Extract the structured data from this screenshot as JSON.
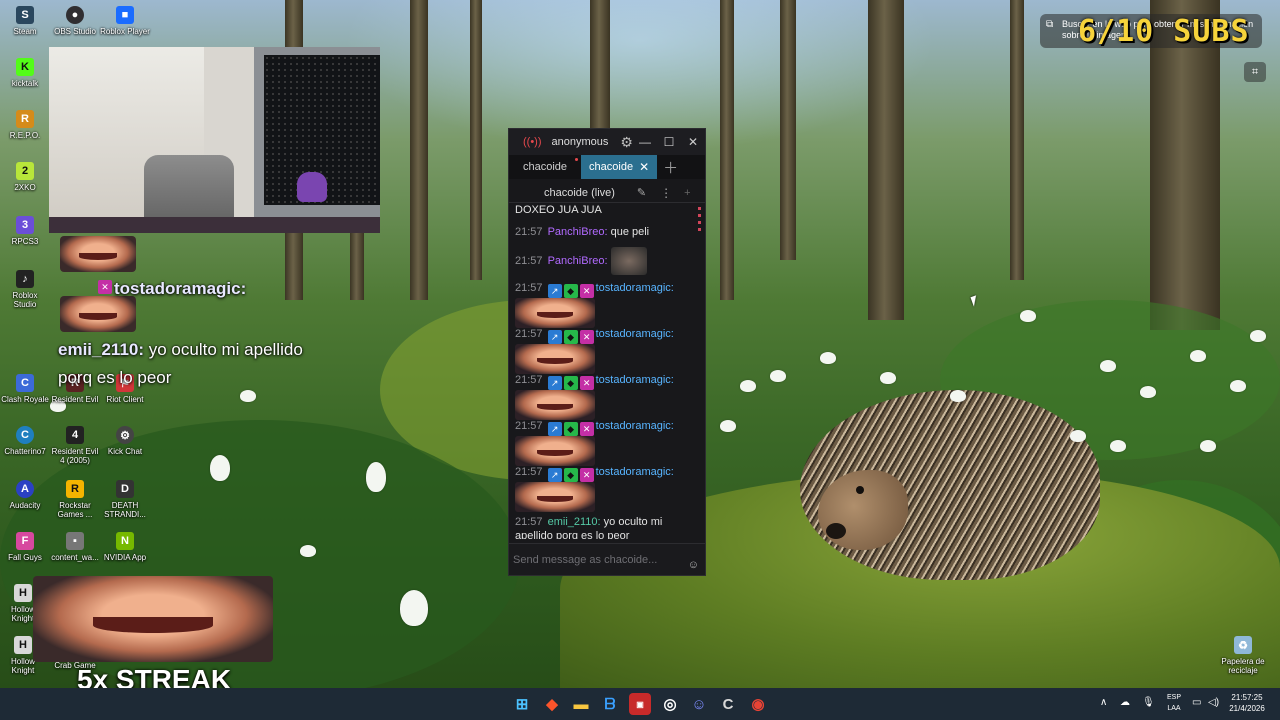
{
  "desktop_icons": [
    {
      "label": "Steam",
      "icon": "steam-icon",
      "color": "#2a475e"
    },
    {
      "label": "OBS Studio",
      "icon": "obs-icon",
      "color": "#302e31"
    },
    {
      "label": "Roblox Player",
      "icon": "roblox-icon",
      "color": "#1b6cff"
    },
    {
      "label": "kicktalk",
      "icon": "kicktalk-icon",
      "color": "#53fc18"
    },
    {
      "label": "R.E.P.O.",
      "icon": "repo-icon",
      "color": "#d58b1a"
    },
    {
      "label": "2XKO",
      "icon": "2xko-icon",
      "color": "#b8e63a"
    },
    {
      "label": "RPCS3",
      "icon": "rpcs3-icon",
      "color": "#6b4fd8"
    },
    {
      "label": "Roblox Studio",
      "icon": "roblox-studio-icon",
      "color": "#222"
    },
    {
      "label": "Clash Royale",
      "icon": "clash-royale-icon",
      "color": "#3c6ad8"
    },
    {
      "label": "Resident Evil",
      "icon": "resident-evil-icon",
      "color": "#5a2222"
    },
    {
      "label": "Riot Client",
      "icon": "riot-client-icon",
      "color": "#d13639"
    },
    {
      "label": "Chatterino7",
      "icon": "chatterino-icon",
      "color": "#1f7fbf"
    },
    {
      "label": "Resident Evil 4 (2005)",
      "icon": "resident-evil-4-icon",
      "color": "#222"
    },
    {
      "label": "Kick Chat",
      "icon": "kick-chat-icon",
      "color": "#444"
    },
    {
      "label": "Audacity",
      "icon": "audacity-icon",
      "color": "#2b41c4"
    },
    {
      "label": "Rockstar Games ...",
      "icon": "rockstar-icon",
      "color": "#f4b400"
    },
    {
      "label": "DEATH STRANDI...",
      "icon": "death-stranding-icon",
      "color": "#333"
    },
    {
      "label": "Fall Guys",
      "icon": "fall-guys-icon",
      "color": "#d7489f"
    },
    {
      "label": "content_wa...",
      "icon": "content-icon",
      "color": "#777"
    },
    {
      "label": "NVIDIA App",
      "icon": "nvidia-icon",
      "color": "#76b900"
    },
    {
      "label": "Hollow Knight",
      "icon": "hollow-knight-icon",
      "color": "#d8d8d8"
    },
    {
      "label": "Crab Game",
      "icon": "crab-game-icon",
      "color": "#c33"
    },
    {
      "label": "Hollow Knight",
      "icon": "hollow-knight-icon",
      "color": "#d8d8d8"
    },
    {
      "label": "Papelera de reciclaje",
      "icon": "recycle-bin-icon",
      "color": "#8fb8d8"
    }
  ],
  "overlay": {
    "alert_user": "tostadoramagic:",
    "alert_chat_user": "emii_2110:",
    "alert_chat_text_line1": " yo oculto mi apellido",
    "alert_chat_text_line2": "porq es lo peor",
    "subs": "6/10 SUBS",
    "streak": "5x STREAK",
    "lens_hint": "Buscar en la web para obtener más información sobre la imagen"
  },
  "chat_window": {
    "title": "anonymous",
    "tabs": [
      {
        "label": "chacoide",
        "active": false
      },
      {
        "label": "chacoide",
        "active": true
      }
    ],
    "split_title": "chacoide (live)",
    "messages": [
      {
        "time": "",
        "user": "",
        "text": "DOXEO JUA JUA"
      },
      {
        "time": "21:57",
        "user": "PanchiBreo:",
        "text": " que peli"
      },
      {
        "time": "21:57",
        "user": "PanchiBreo:",
        "text": ""
      },
      {
        "time": "21:57",
        "user": "tostadoramagic:",
        "text": ""
      },
      {
        "time": "21:57",
        "user": "tostadoramagic:",
        "text": ""
      },
      {
        "time": "21:57",
        "user": "tostadoramagic:",
        "text": ""
      },
      {
        "time": "21:57",
        "user": "tostadoramagic:",
        "text": ""
      },
      {
        "time": "21:57",
        "user": "tostadoramagic:",
        "text": ""
      },
      {
        "time": "21:57",
        "user": "emii_2110:",
        "text": " yo oculto mi apellido porq es lo peor"
      }
    ],
    "input_placeholder": "Send message as chacoide..."
  },
  "taskbar": {
    "apps": [
      "start-icon",
      "brave-icon",
      "file-explorer-icon",
      "bing-icon",
      "media-icon",
      "obs-icon",
      "discord-icon",
      "chatterino-icon",
      "chrome-icon"
    ],
    "language_line1": "ESP",
    "language_line2": "LAA",
    "time": "21:57:25",
    "date": "21/4/2026"
  }
}
